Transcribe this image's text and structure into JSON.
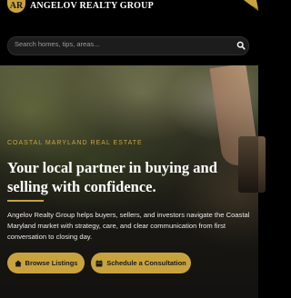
{
  "header": {
    "logo_initials": "AR",
    "brand_name": "ANGELOV REALTY GROUP"
  },
  "search": {
    "placeholder": "Search homes, tips, areas..."
  },
  "hero": {
    "eyebrow": "COASTAL MARYLAND REAL ESTATE",
    "headline": "Your local partner in buying and selling with confidence.",
    "description": "Angelov Realty Group helps buyers, sellers, and investors navigate the Coastal Maryland market with strategy, care, and clear communication from first conversation to closing day.",
    "primary_cta": "Browse Listings",
    "secondary_cta": "Schedule a Consultation"
  },
  "colors": {
    "accent_gold": "#c8a33d",
    "background": "#000000"
  },
  "icons": {
    "search": "search-icon",
    "browse": "home-icon",
    "schedule": "calendar-icon",
    "corner": "menu-icon"
  }
}
